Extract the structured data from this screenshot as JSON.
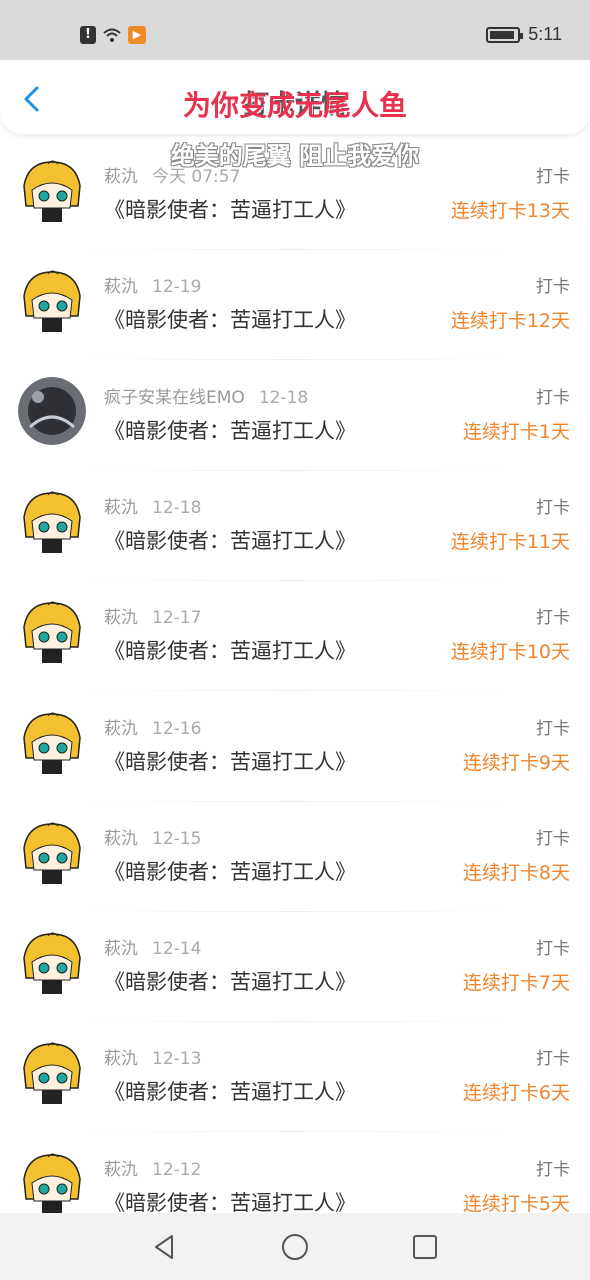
{
  "status_bar": {
    "time": "5:11",
    "notice_icon": "notification-icon",
    "app_icon": "media-app-icon"
  },
  "header": {
    "title": "打卡详情",
    "back_icon": "back-arrow-icon"
  },
  "lyrics": {
    "line1": "为你变成无尾人鱼",
    "line2": "绝美的尾翼 阻止我爱你"
  },
  "colors": {
    "accent": "#1e90e6",
    "streak": "#f0852e",
    "lyric": "#e8304f"
  },
  "items": [
    {
      "user": "萩氿",
      "date": "今天 07:57",
      "tag": "打卡",
      "title": "《暗影使者：苦逼打工人》",
      "streak": "连续打卡13天",
      "avatar": "anime-avatar"
    },
    {
      "user": "萩氿",
      "date": "12-19",
      "tag": "打卡",
      "title": "《暗影使者：苦逼打工人》",
      "streak": "连续打卡12天",
      "avatar": "anime-avatar"
    },
    {
      "user": "疯子安某在线EMO",
      "date": "12-18",
      "tag": "打卡",
      "title": "《暗影使者：苦逼打工人》",
      "streak": "连续打卡1天",
      "avatar": "dark-avatar"
    },
    {
      "user": "萩氿",
      "date": "12-18",
      "tag": "打卡",
      "title": "《暗影使者：苦逼打工人》",
      "streak": "连续打卡11天",
      "avatar": "anime-avatar"
    },
    {
      "user": "萩氿",
      "date": "12-17",
      "tag": "打卡",
      "title": "《暗影使者：苦逼打工人》",
      "streak": "连续打卡10天",
      "avatar": "anime-avatar"
    },
    {
      "user": "萩氿",
      "date": "12-16",
      "tag": "打卡",
      "title": "《暗影使者：苦逼打工人》",
      "streak": "连续打卡9天",
      "avatar": "anime-avatar"
    },
    {
      "user": "萩氿",
      "date": "12-15",
      "tag": "打卡",
      "title": "《暗影使者：苦逼打工人》",
      "streak": "连续打卡8天",
      "avatar": "anime-avatar"
    },
    {
      "user": "萩氿",
      "date": "12-14",
      "tag": "打卡",
      "title": "《暗影使者：苦逼打工人》",
      "streak": "连续打卡7天",
      "avatar": "anime-avatar"
    },
    {
      "user": "萩氿",
      "date": "12-13",
      "tag": "打卡",
      "title": "《暗影使者：苦逼打工人》",
      "streak": "连续打卡6天",
      "avatar": "anime-avatar"
    },
    {
      "user": "萩氿",
      "date": "12-12",
      "tag": "打卡",
      "title": "《暗影使者：苦逼打工人》",
      "streak": "连续打卡5天",
      "avatar": "anime-avatar"
    }
  ],
  "nav_bar": {
    "back": "nav-back-icon",
    "home": "nav-home-icon",
    "recents": "nav-recents-icon"
  }
}
